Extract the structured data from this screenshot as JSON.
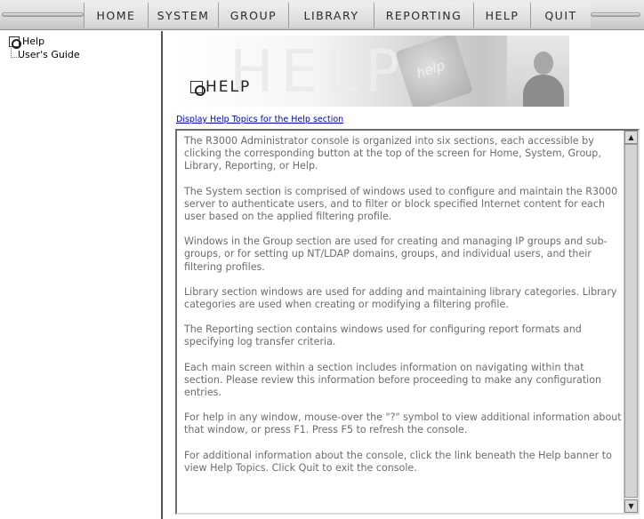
{
  "nav": {
    "items": [
      "HOME",
      "SYSTEM",
      "GROUP",
      "LIBRARY",
      "REPORTING",
      "HELP",
      "QUIT"
    ]
  },
  "tree": {
    "root": {
      "label": "Help",
      "icon": "help-icon"
    },
    "child": {
      "label": "User's Guide"
    }
  },
  "banner": {
    "ghost_text": "HELP",
    "photo_text": "help",
    "title": "HELP",
    "icon": "help-icon"
  },
  "help_link": "Display Help Topics for the Help section",
  "help_text": {
    "paragraphs": [
      "The R3000 Administrator console is organized into six sections, each accessible by clicking the corresponding button at the top of the screen for Home, System, Group, Library, Reporting, or Help.",
      "The System section is comprised of windows used to configure and maintain the R3000 server to authenticate users, and to filter or block specified Internet content for each user based on the applied filtering profile.",
      "Windows in the Group section are used for creating and managing IP groups and sub-groups, or for setting up NT/LDAP domains, groups, and individual users, and their filtering profiles.",
      "Library section windows are used for adding and maintaining library categories. Library categories are used when creating or modifying a filtering profile.",
      "The Reporting section contains windows used for configuring report formats and specifying log transfer criteria.",
      "Each main screen within a section includes information on navigating within that section. Please review this information before proceeding to make any configuration entries.",
      "For help in any window, mouse-over the \"?\" symbol to view additional information about that window, or press F1. Press F5 to refresh the console.",
      "For additional information about the console, click the link beneath the Help banner to view Help Topics. Click Quit to exit the console."
    ]
  },
  "scrollbar": {
    "up_glyph": "▲",
    "down_glyph": "▼"
  }
}
